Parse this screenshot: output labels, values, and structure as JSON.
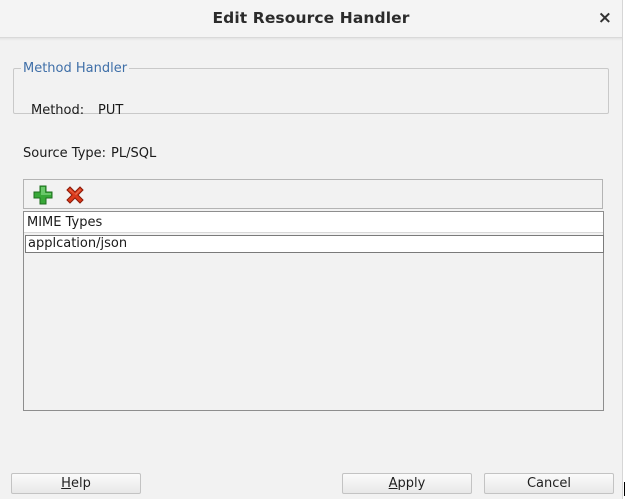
{
  "dialog": {
    "title": "Edit Resource Handler",
    "close_glyph": "×"
  },
  "method_handler": {
    "legend": "Method Handler",
    "method_label": "Method:",
    "method_value": "PUT"
  },
  "source": {
    "label": "Source Type:",
    "value": "PL/SQL"
  },
  "toolbar": {
    "add_icon": "add-icon",
    "remove_icon": "remove-icon",
    "add_color": "#2e9e2e",
    "remove_color": "#d4361a"
  },
  "mime_table": {
    "header": "MIME Types",
    "rows": [
      "applcation/json"
    ]
  },
  "buttons": {
    "help": "Help",
    "apply": "Apply",
    "cancel": "Cancel"
  }
}
